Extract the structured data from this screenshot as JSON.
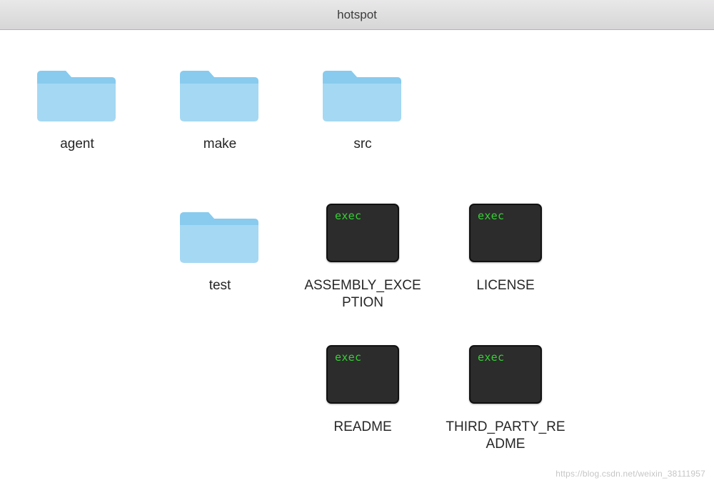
{
  "window": {
    "title": "hotspot"
  },
  "exec_badge": "exec",
  "items": [
    {
      "name": "agent",
      "kind": "folder"
    },
    {
      "name": "make",
      "kind": "folder"
    },
    {
      "name": "src",
      "kind": "folder"
    },
    {
      "name": "test",
      "kind": "folder"
    },
    {
      "name": "ASSEMBLY_EXCEPTION",
      "kind": "exec"
    },
    {
      "name": "LICENSE",
      "kind": "exec"
    },
    {
      "name": "README",
      "kind": "exec"
    },
    {
      "name": "THIRD_PARTY_README",
      "kind": "exec"
    }
  ],
  "watermark": "https://blog.csdn.net/weixin_38111957"
}
